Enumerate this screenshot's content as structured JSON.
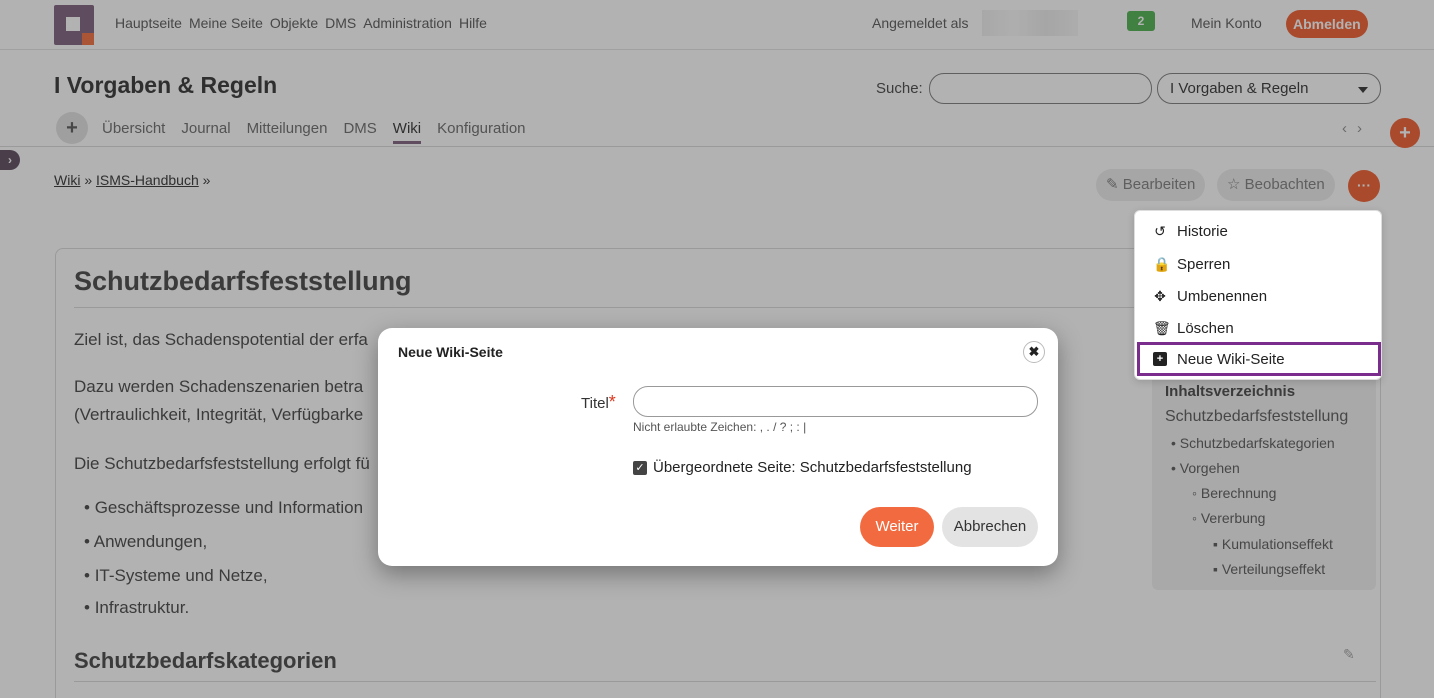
{
  "topnav": {
    "items": [
      "Hauptseite",
      "Meine Seite",
      "Objekte",
      "DMS",
      "Administration",
      "Hilfe"
    ],
    "logged_in_label": "Angemeldet als",
    "notification_count": "2",
    "my_account": "Mein Konto",
    "logout": "Abmelden"
  },
  "project": {
    "title": "I Vorgaben & Regeln",
    "search_label": "Suche:",
    "search_value": "",
    "project_select": "I Vorgaben & Regeln",
    "add_symbol": "+",
    "tabs": [
      "Übersicht",
      "Journal",
      "Mitteilungen",
      "DMS",
      "Wiki",
      "Konfiguration"
    ],
    "active_tab": "Wiki",
    "tab_prev": "‹",
    "tab_next": "›",
    "new_symbol": "+"
  },
  "breadcrumb": {
    "root": "Wiki",
    "sep1": "»",
    "parent": "ISMS-Handbuch",
    "sep2": "»"
  },
  "actions": {
    "edit": "Bearbeiten",
    "watch": "Beobachten",
    "more": "···"
  },
  "menu": {
    "items": [
      {
        "icon": "history-icon",
        "label": "Historie"
      },
      {
        "icon": "lock-icon",
        "label": "Sperren"
      },
      {
        "icon": "move-icon",
        "label": "Umbenennen"
      },
      {
        "icon": "trash-icon",
        "label": "Löschen"
      },
      {
        "icon": "plus-square-icon",
        "label": "Neue Wiki-Seite"
      }
    ],
    "highlight_color": "#7b2d8e"
  },
  "wiki": {
    "title": "Schutzbedarfsfeststellung",
    "para1": "Ziel ist, das Schadenspotential der erfa",
    "para2a": "Dazu werden Schadenszenarien betra",
    "para2b": "(Vertraulichkeit, Integrität, Verfügbarke",
    "para3": "Die Schutzbedarfsfeststellung erfolgt fü",
    "bullets": [
      "Geschäftsprozesse und Information",
      "Anwendungen,",
      "IT-Systeme und Netze,",
      "Infrastruktur."
    ],
    "section2": "Schutzbedarfskategorien"
  },
  "toc": {
    "heading": "Inhaltsverzeichnis",
    "root": "Schutzbedarfsfeststellung",
    "items": [
      {
        "level": 1,
        "label": "Schutzbedarfskategorien"
      },
      {
        "level": 1,
        "label": "Vorgehen"
      },
      {
        "level": 2,
        "label": "Berechnung"
      },
      {
        "level": 2,
        "label": "Vererbung"
      },
      {
        "level": 3,
        "label": "Kumulationseffekt"
      },
      {
        "level": 3,
        "label": "Verteilungseffekt"
      }
    ]
  },
  "modal": {
    "title": "Neue Wiki-Seite",
    "field_label": "Titel",
    "required_mark": "*",
    "field_value": "",
    "hint": "Nicht erlaubte Zeichen: , . / ? ; : |",
    "checkbox_label": "Übergeordnete Seite: Schutzbedarfsfeststellung",
    "checkbox_checked": true,
    "submit": "Weiter",
    "cancel": "Abbrechen"
  },
  "colors": {
    "accent": "#f26a3f",
    "brand": "#8a6d88",
    "badge": "#5cb85c"
  }
}
